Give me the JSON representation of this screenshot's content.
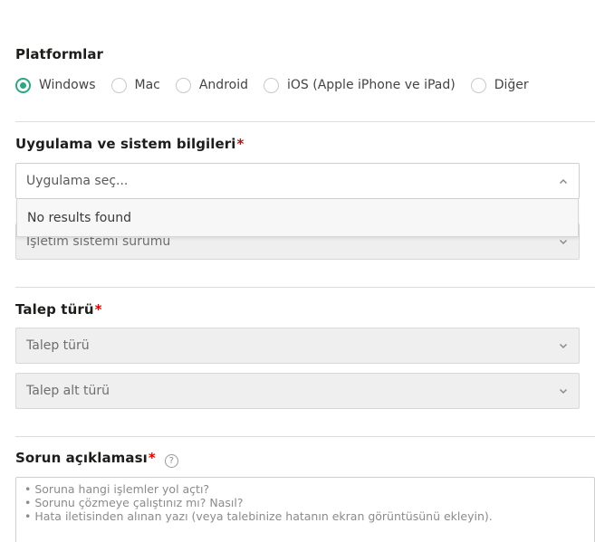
{
  "platforms": {
    "title": "Platformlar",
    "options": [
      {
        "label": "Windows",
        "checked": true
      },
      {
        "label": "Mac",
        "checked": false
      },
      {
        "label": "Android",
        "checked": false
      },
      {
        "label": "iOS (Apple iPhone ve iPad)",
        "checked": false
      },
      {
        "label": "Diğer",
        "checked": false
      }
    ]
  },
  "app_info": {
    "title": "Uygulama ve sistem bilgileri",
    "required_mark": "*",
    "app_select_placeholder": "Uygulama seç...",
    "dropdown_message": "No results found",
    "os_version_placeholder": "İşletim sistemi sürümü"
  },
  "request_type": {
    "title": "Talep türü",
    "required_mark": "*",
    "type_placeholder": "Talep türü",
    "subtype_placeholder": "Talep alt türü"
  },
  "problem": {
    "title": "Sorun açıklaması",
    "required_mark": "*",
    "help_icon_glyph": "?",
    "placeholder_lines": [
      "• Soruna hangi işlemler yol açtı?",
      "• Sorunu çözmeye çalıştınız mı? Nasıl?",
      "• Hata iletisinden alınan yazı (veya talebinize hatanın ekran görüntüsünü ekleyin)."
    ]
  },
  "colors": {
    "accent": "#29a97f",
    "required": "#dd0000"
  }
}
